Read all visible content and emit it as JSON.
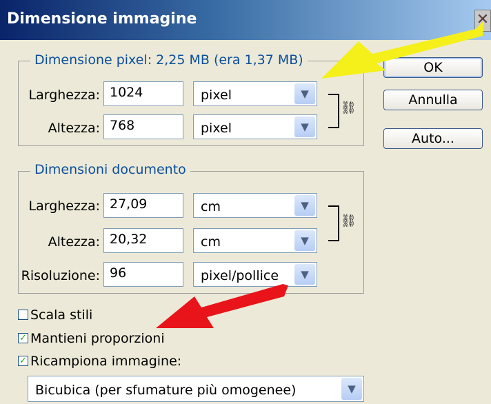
{
  "window": {
    "title": "Dimensione immagine",
    "close_glyph": "✕"
  },
  "pixel_group": {
    "legend": "Dimensione pixel:  2,25 MB (era 1,37 MB)",
    "width_label": "Larghezza:",
    "width_value": "1024",
    "width_unit": "pixel",
    "height_label": "Altezza:",
    "height_value": "768",
    "height_unit": "pixel"
  },
  "doc_group": {
    "legend": "Dimensioni documento",
    "width_label": "Larghezza:",
    "width_value": "27,09",
    "width_unit": "cm",
    "height_label": "Altezza:",
    "height_value": "20,32",
    "height_unit": "cm",
    "res_label": "Risoluzione:",
    "res_value": "96",
    "res_unit": "pixel/pollice"
  },
  "buttons": {
    "ok": "OK",
    "cancel": "Annulla",
    "auto": "Auto..."
  },
  "options": {
    "scale_styles": {
      "label": "Scala stili",
      "checked": false
    },
    "constrain": {
      "label": "Mantieni proporzioni",
      "checked": true
    },
    "resample": {
      "label": "Ricampiona immagine:",
      "checked": true
    },
    "method": "Bicubica (per sfumature più omogenee)"
  },
  "icons": {
    "dropdown": "chevron-down-icon",
    "link": "chain-link-icon",
    "check": "checkmark-icon"
  },
  "colors": {
    "title_start": "#0a246a",
    "title_end": "#a6caf0",
    "legend": "#0b4f9b",
    "yellow_arrow": "#f5f01a",
    "red_arrow": "#e8141a"
  }
}
